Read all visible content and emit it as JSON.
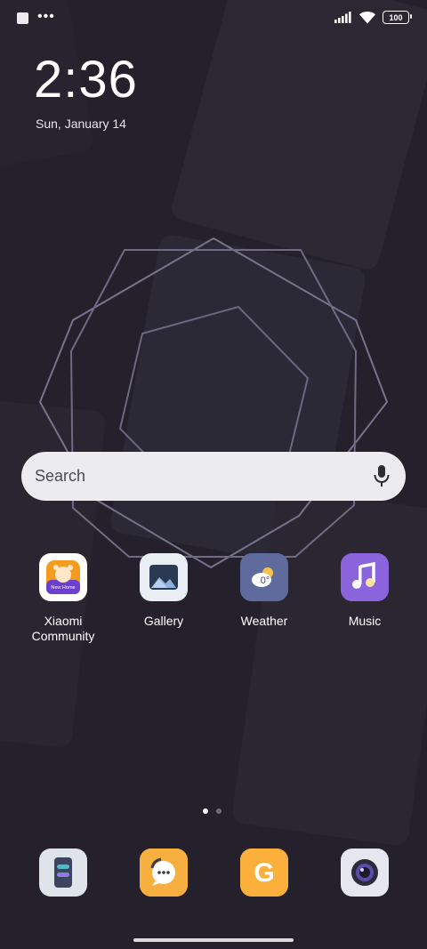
{
  "status_bar": {
    "left_icons": [
      "notification-square-icon",
      "more-dots-icon"
    ],
    "right_icons": [
      "signal-icon",
      "wifi-icon",
      "battery-icon"
    ],
    "battery_level": "100"
  },
  "clock": {
    "time": "2:36",
    "date": "Sun, January 14"
  },
  "search": {
    "placeholder": "Search",
    "icon": "microphone-icon"
  },
  "apps": [
    {
      "label": "Xiaomi\nCommunity",
      "icon": "xiaomi-community-icon",
      "badge_text": "New Home",
      "color": "#f39c1f"
    },
    {
      "label": "Gallery",
      "icon": "gallery-icon",
      "color": "#e9eef5"
    },
    {
      "label": "Weather",
      "icon": "weather-icon",
      "temp": "0°",
      "color": "#5e6b9c"
    },
    {
      "label": "Music",
      "icon": "music-icon",
      "color": "#8b63dc"
    }
  ],
  "pager": {
    "pages": 2,
    "current": 1
  },
  "dock": [
    {
      "icon": "file-manager-icon",
      "color": "#dfe3ea"
    },
    {
      "icon": "messages-icon",
      "color": "#f7b040"
    },
    {
      "icon": "getapps-icon",
      "letter": "G",
      "color": "#fbb03b"
    },
    {
      "icon": "camera-icon",
      "color": "#e6e6ee"
    }
  ],
  "colors": {
    "background": "#24212c",
    "search_bg": "#ececf0",
    "accent": "#ffffff"
  }
}
